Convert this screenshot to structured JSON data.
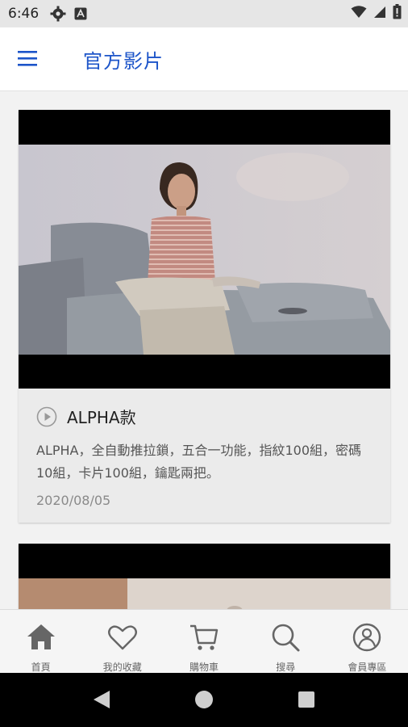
{
  "status_bar": {
    "time": "6:46",
    "icons": [
      "settings-gear-icon",
      "text-a-icon",
      "wifi-icon",
      "signal-icon",
      "battery-icon"
    ]
  },
  "app_bar": {
    "menu_icon": "hamburger-menu-icon",
    "title": "官方影片",
    "title_color": "#1d55c9"
  },
  "videos": [
    {
      "title": "ALPHA款",
      "description": "ALPHA，全自動推拉鎖，五合一功能，指紋100組，密碼10組，卡片100組，鑰匙兩把。",
      "date": "2020/08/05",
      "play_icon": "play-circle-icon"
    }
  ],
  "bottom_nav": {
    "items": [
      {
        "label": "首頁",
        "icon": "home-icon"
      },
      {
        "label": "我的收藏",
        "icon": "heart-icon"
      },
      {
        "label": "購物車",
        "icon": "cart-icon"
      },
      {
        "label": "搜尋",
        "icon": "search-icon"
      },
      {
        "label": "會員專區",
        "icon": "user-icon"
      }
    ]
  },
  "system_nav": [
    "back-icon",
    "home-circle-icon",
    "recents-icon"
  ]
}
